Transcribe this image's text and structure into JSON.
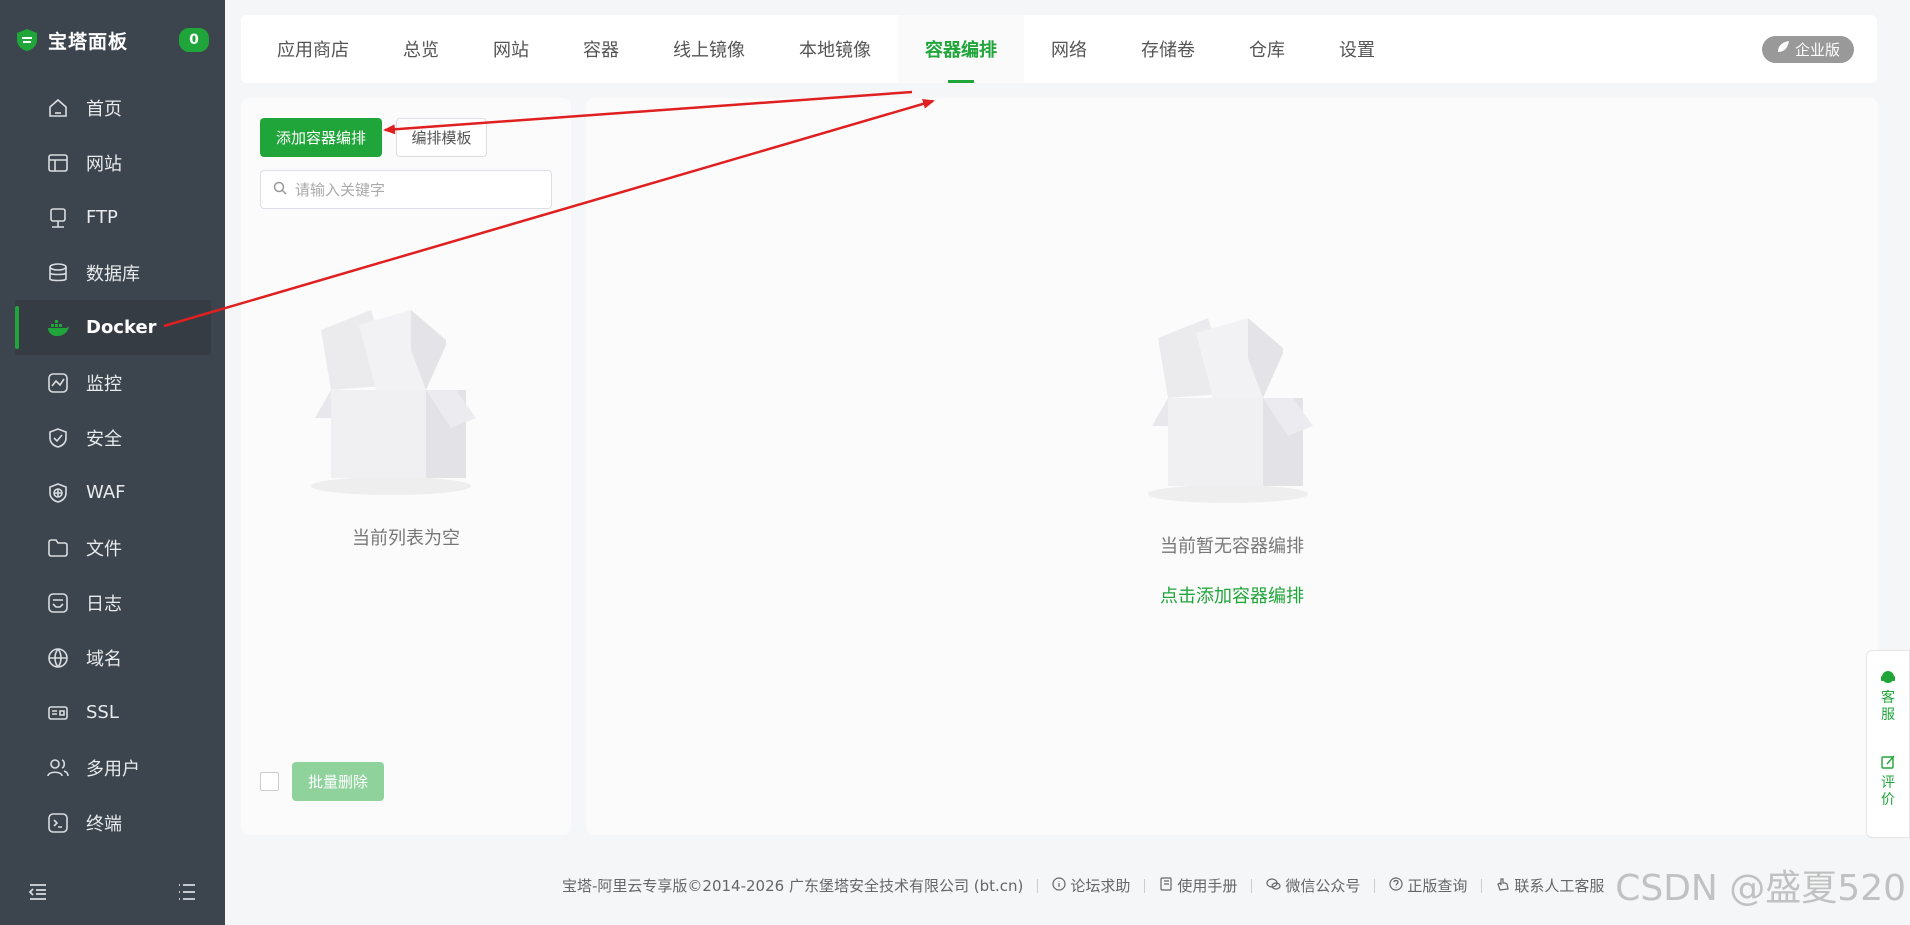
{
  "sidebar": {
    "brand": "宝塔面板",
    "badge": "0",
    "items": [
      {
        "label": "首页",
        "icon": "home-icon"
      },
      {
        "label": "网站",
        "icon": "website-icon"
      },
      {
        "label": "FTP",
        "icon": "ftp-icon"
      },
      {
        "label": "数据库",
        "icon": "database-icon"
      },
      {
        "label": "Docker",
        "icon": "docker-icon",
        "active": true
      },
      {
        "label": "监控",
        "icon": "monitor-icon"
      },
      {
        "label": "安全",
        "icon": "shield-icon"
      },
      {
        "label": "WAF",
        "icon": "waf-icon"
      },
      {
        "label": "文件",
        "icon": "folder-icon"
      },
      {
        "label": "日志",
        "icon": "log-icon"
      },
      {
        "label": "域名",
        "icon": "www-icon"
      },
      {
        "label": "SSL",
        "icon": "ssl-icon"
      },
      {
        "label": "多用户",
        "icon": "users-icon"
      },
      {
        "label": "终端",
        "icon": "terminal-icon"
      }
    ]
  },
  "tabs": [
    "应用商店",
    "总览",
    "网站",
    "容器",
    "线上镜像",
    "本地镜像",
    "容器编排",
    "网络",
    "存储卷",
    "仓库",
    "设置"
  ],
  "active_tab": "容器编排",
  "enterprise_label": "企业版",
  "left": {
    "add_button": "添加容器编排",
    "template_button": "编排模板",
    "search_placeholder": "请输入关键字",
    "empty_text": "当前列表为空",
    "batch_delete": "批量删除"
  },
  "right": {
    "empty_text": "当前暂无容器编排",
    "add_link": "点击添加容器编排"
  },
  "footer": {
    "copyright": "宝塔-阿里云专享版©2014-2026 广东堡塔安全技术有限公司 (bt.cn)",
    "links": [
      "论坛求助",
      "使用手册",
      "微信公众号",
      "正版查询",
      "联系人工客服"
    ]
  },
  "float": {
    "service": [
      "客",
      "服"
    ],
    "review": [
      "评",
      "价"
    ]
  },
  "watermark": "CSDN @盛夏520",
  "colors": {
    "accent": "#20a53a",
    "sidebar": "#3c444d",
    "arrow": "#e02020"
  }
}
